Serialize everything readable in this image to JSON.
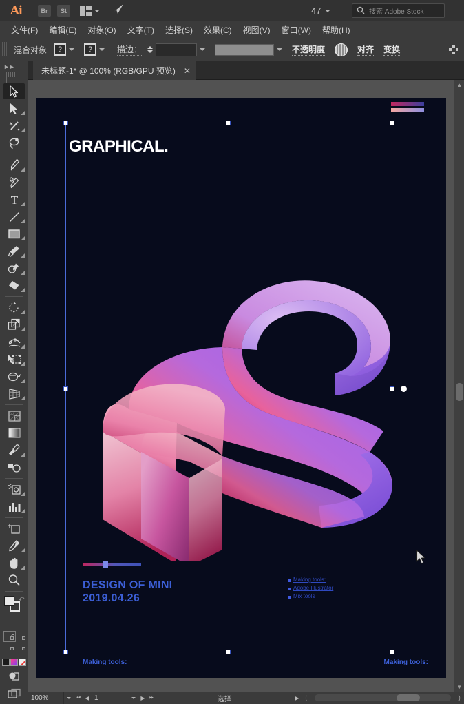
{
  "app": {
    "logo": "Ai",
    "bridge_label": "Br",
    "stock_label": "St",
    "arrange_icon": "arrange-documents-icon",
    "sync_icon": "sync-icon",
    "number_value": "47",
    "minimize_label": "—"
  },
  "search": {
    "icon": "search-icon",
    "placeholder": "搜索 Adobe Stock"
  },
  "menu": {
    "items": [
      {
        "label": "文件(F)",
        "name": "menu-file"
      },
      {
        "label": "编辑(E)",
        "name": "menu-edit"
      },
      {
        "label": "对象(O)",
        "name": "menu-object"
      },
      {
        "label": "文字(T)",
        "name": "menu-type"
      },
      {
        "label": "选择(S)",
        "name": "menu-select"
      },
      {
        "label": "效果(C)",
        "name": "menu-effect"
      },
      {
        "label": "视图(V)",
        "name": "menu-view"
      },
      {
        "label": "窗口(W)",
        "name": "menu-window"
      },
      {
        "label": "帮助(H)",
        "name": "menu-help"
      }
    ]
  },
  "control_bar": {
    "object_label": "混合对象",
    "fill_swatch": "?",
    "stroke_swatch": "?",
    "stroke_label": "描边：",
    "stroke_value": "",
    "brush_value": "",
    "opacity_label": "不透明度",
    "blend_mode_icon": "blend-mode-icon",
    "align_label": "对齐",
    "transform_label": "变换",
    "more_options_icon": "more-options-icon"
  },
  "document_tab": {
    "title": "未标题-1* @ 100% (RGB/GPU 预览)",
    "close_label": "✕"
  },
  "toolbar": {
    "expand_icon": "expand-panel-icon",
    "tools": [
      {
        "name": "selection-tool",
        "label": "选择工具",
        "icon": "arrow-outline-icon",
        "active": true,
        "corner": false
      },
      {
        "name": "direct-selection-tool",
        "label": "直接选择工具",
        "icon": "arrow-filled-icon",
        "active": false,
        "corner": true
      },
      {
        "name": "magic-wand-tool",
        "label": "魔棒工具",
        "icon": "magic-wand-icon",
        "active": false,
        "corner": true
      },
      {
        "name": "lasso-tool",
        "label": "套索工具",
        "icon": "lasso-icon",
        "active": false,
        "corner": false
      },
      {
        "name": "pen-tool",
        "label": "钢笔工具",
        "icon": "pen-icon",
        "active": false,
        "corner": true
      },
      {
        "name": "curvature-tool",
        "label": "曲率工具",
        "icon": "curvature-icon",
        "active": false,
        "corner": false
      },
      {
        "name": "type-tool",
        "label": "文字工具",
        "icon": "type-t-icon",
        "active": false,
        "corner": true
      },
      {
        "name": "line-segment-tool",
        "label": "直线段工具",
        "icon": "line-icon",
        "active": false,
        "corner": true
      },
      {
        "name": "rectangle-tool",
        "label": "矩形工具",
        "icon": "rectangle-icon",
        "active": false,
        "corner": true
      },
      {
        "name": "paintbrush-tool",
        "label": "画笔工具",
        "icon": "paintbrush-icon",
        "active": false,
        "corner": true
      },
      {
        "name": "shaper-tool",
        "label": "Shaper 工具",
        "icon": "shaper-pencil-icon",
        "active": false,
        "corner": true
      },
      {
        "name": "eraser-tool",
        "label": "橡皮擦工具",
        "icon": "eraser-icon",
        "active": false,
        "corner": true
      },
      {
        "name": "rotate-tool",
        "label": "旋转工具",
        "icon": "rotate-icon",
        "active": false,
        "corner": true
      },
      {
        "name": "scale-tool",
        "label": "比例缩放工具",
        "icon": "scale-icon",
        "active": false,
        "corner": true
      },
      {
        "name": "width-tool",
        "label": "宽度工具",
        "icon": "width-warp-icon",
        "active": false,
        "corner": true
      },
      {
        "name": "free-transform-tool",
        "label": "自由变换工具",
        "icon": "free-transform-icon",
        "active": false,
        "corner": true
      },
      {
        "name": "shape-builder-tool",
        "label": "形状生成器工具",
        "icon": "shape-builder-icon",
        "active": false,
        "corner": true
      },
      {
        "name": "perspective-grid-tool",
        "label": "透视网格工具",
        "icon": "perspective-grid-icon",
        "active": false,
        "corner": true
      },
      {
        "name": "mesh-tool",
        "label": "网格工具",
        "icon": "mesh-icon",
        "active": false,
        "corner": false
      },
      {
        "name": "gradient-tool",
        "label": "渐变工具",
        "icon": "gradient-icon",
        "active": false,
        "corner": false
      },
      {
        "name": "eyedropper-tool",
        "label": "吸管工具",
        "icon": "eyedropper-icon",
        "active": false,
        "corner": true
      },
      {
        "name": "blend-tool",
        "label": "混合工具",
        "icon": "blend-shapes-icon",
        "active": false,
        "corner": false
      },
      {
        "name": "symbol-sprayer-tool",
        "label": "符号喷枪工具",
        "icon": "symbol-sprayer-icon",
        "active": false,
        "corner": true
      },
      {
        "name": "column-graph-tool",
        "label": "柱形图工具",
        "icon": "bar-chart-icon",
        "active": false,
        "corner": true
      },
      {
        "name": "artboard-tool",
        "label": "画板工具",
        "icon": "artboard-icon",
        "active": false,
        "corner": false
      },
      {
        "name": "slice-tool",
        "label": "切片工具",
        "icon": "slice-knife-icon",
        "active": false,
        "corner": true
      },
      {
        "name": "hand-tool",
        "label": "抓手工具",
        "icon": "hand-icon",
        "active": false,
        "corner": true
      },
      {
        "name": "zoom-tool",
        "label": "缩放工具",
        "icon": "magnifier-icon",
        "active": false,
        "corner": false
      }
    ],
    "fill_stroke": {
      "fill_name": "fill-swatch",
      "stroke_name": "stroke-swatch",
      "swap_icon": "swap-fill-stroke-icon",
      "default_icon": "default-fill-stroke-icon",
      "question_mark": "?",
      "color_mode_icon": "color-swatch-icon",
      "gradient_mode_icon": "gradient-swatch-icon",
      "none_mode_icon": "none-swatch-icon"
    },
    "drawing_mode_icon": "drawing-mode-icon",
    "screen_mode_icon": "screen-mode-icon"
  },
  "artwork": {
    "heading": "GRAPHICAL.",
    "stripe_top_name": "gradient-stripe-top",
    "stripe_bottom_name": "gradient-stripe-bottom",
    "ribbon_name": "3d-ribbon-artwork",
    "gradient_bar_name": "gradient-slider-bar",
    "design_line1": "DESIGN OF MINI",
    "design_line2": "2019.04.26",
    "side_list": [
      "Making tools:",
      "Adobe Illustrator",
      "Mix tools"
    ],
    "footer_left": "Making tools:",
    "footer_right": "Making tools:",
    "colors": {
      "background": "#070b1c",
      "heading": "#ffffff",
      "accent_blue": "#3c5fd6",
      "ribbon_pink": "#f06a9a",
      "ribbon_magenta": "#c7275f",
      "ribbon_purple": "#9b6ce8",
      "selection": "#4a6bd8"
    }
  },
  "status_bar": {
    "zoom_value": "100%",
    "first_page_icon": "first-page-icon",
    "prev_page_icon": "prev-page-icon",
    "page_value": "1",
    "next_page_icon": "next-page-icon",
    "last_page_icon": "last-page-icon",
    "selection_label": "选择",
    "play_icon": "play-icon",
    "scroll_left_icon": "scroll-left-icon",
    "scroll_right_icon": "scroll-right-icon"
  },
  "scrollbar": {
    "up_icon": "scroll-up-icon",
    "down_icon": "scroll-down-icon",
    "thumb_name": "vertical-scroll-thumb"
  }
}
